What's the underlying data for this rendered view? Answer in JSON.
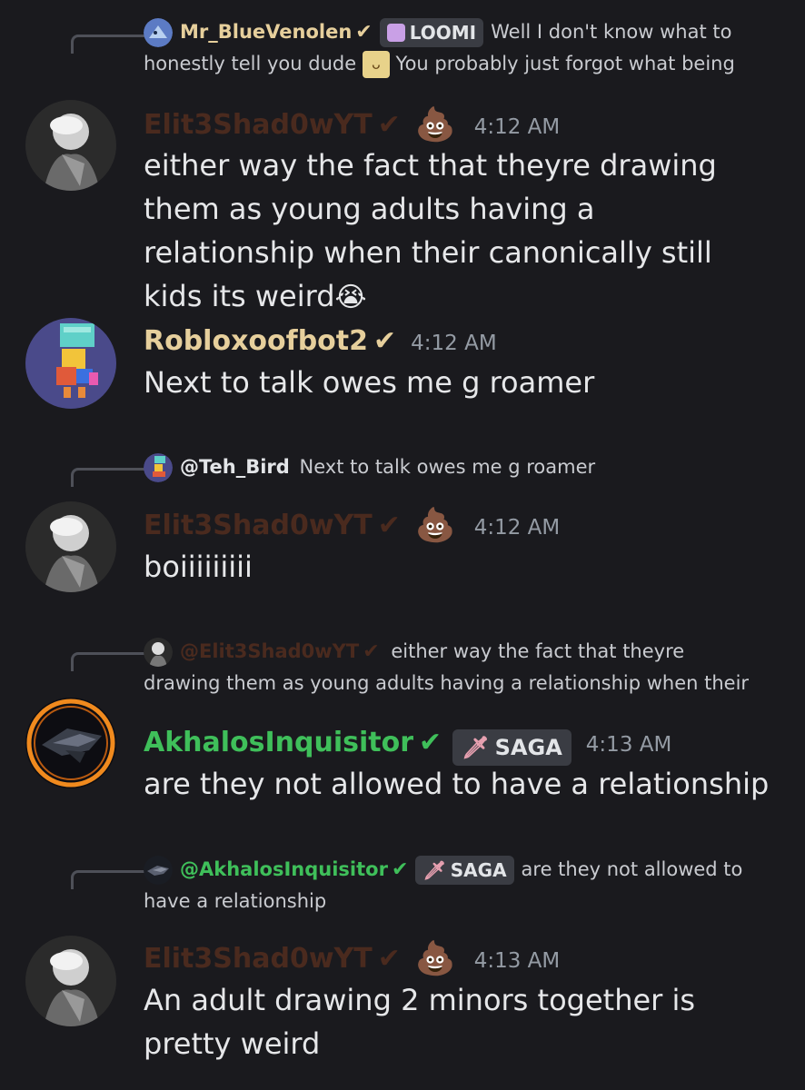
{
  "messages": [
    {
      "reply": {
        "name": "Mr_BlueVenolen",
        "tag": "LOOMI",
        "text_line1": "Well I don't know what to",
        "text_line2a": "honestly tell you dude",
        "text_line2b": "You probably just forgot what being"
      },
      "author": "Elit3Shad0wYT",
      "time": "4:12 AM",
      "body": "either way the fact that theyre drawing them as young adults having a relationship when their canonically still kids its weird",
      "body_emoji": "😭"
    },
    {
      "author": "Robloxoofbot2",
      "time": "4:12 AM",
      "body": "Next to talk owes me g roamer"
    },
    {
      "reply": {
        "name": "@Teh_Bird",
        "text": "Next to talk owes me g roamer"
      },
      "author": "Elit3Shad0wYT",
      "time": "4:12 AM",
      "body": "boiiiiiiiii"
    },
    {
      "reply": {
        "name": "@Elit3Shad0wYT",
        "text_line1": "either way the fact that theyre",
        "text_line2": "drawing them as young adults having a relationship when their"
      },
      "author": "AkhalosInquisitor",
      "tag": "SAGA",
      "time": "4:13 AM",
      "body": "are they not allowed to have a relationship"
    },
    {
      "reply": {
        "name": "@AkhalosInquisitor",
        "tag": "SAGA",
        "text_line1": "are they not allowed to",
        "text_line2": "have a relationship"
      },
      "author": "Elit3Shad0wYT",
      "time": "4:13 AM",
      "body": "An adult drawing 2 minors together is pretty weird"
    }
  ],
  "colors": {
    "background": "#1a1a1e",
    "elit_name": "#4a2a1e",
    "roblox_name": "#e6cf9c",
    "akhalos_name": "#3fbf5a",
    "blue_name": "#e6cf9c",
    "timestamp": "#949ba4"
  },
  "icons": {
    "check": "heavy-check-mark",
    "poop": "pile-of-poo",
    "cry": "loudly-crying-face"
  }
}
